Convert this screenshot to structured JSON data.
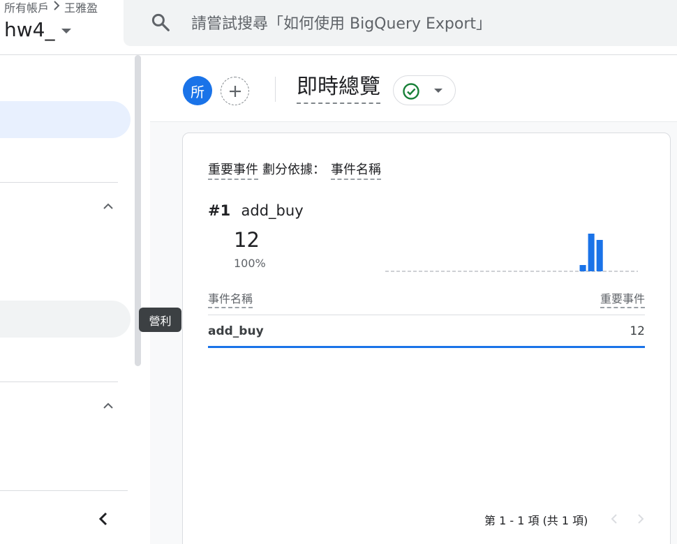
{
  "topbar": {
    "breadcrumb": {
      "accounts": "所有帳戶",
      "account": "王雅盈"
    },
    "property": "hw4_",
    "search": {
      "placeholder": "請嘗試搜尋「如何使用 BigQuery Export」"
    }
  },
  "sidebar": {
    "tooltip": "營利"
  },
  "header": {
    "avatar_letter": "所",
    "add_comparison": "+",
    "report_title": "即時總覽",
    "status": "check"
  },
  "card": {
    "metric": "重要事件",
    "breakdown_label": "劃分依據：",
    "dimension": "事件名稱",
    "top_rank": "#1",
    "top_name": "add_buy",
    "top_value": "12",
    "top_percent": "100%",
    "table": {
      "col_dimension": "事件名稱",
      "col_metric": "重要事件",
      "rows": [
        {
          "name": "add_buy",
          "value": "12"
        }
      ]
    },
    "pagination": "第 1 - 1 項 (共 1 項)"
  },
  "chart_data": {
    "type": "bar",
    "values": [
      0,
      0,
      0,
      0,
      0,
      0,
      0,
      0,
      0,
      0,
      0,
      0,
      0,
      0,
      0,
      0,
      0,
      0,
      0,
      0,
      0,
      0,
      0,
      1,
      6,
      5,
      0,
      0,
      0,
      0
    ],
    "ylim": [
      0,
      6
    ],
    "color": "#1a73e8"
  }
}
